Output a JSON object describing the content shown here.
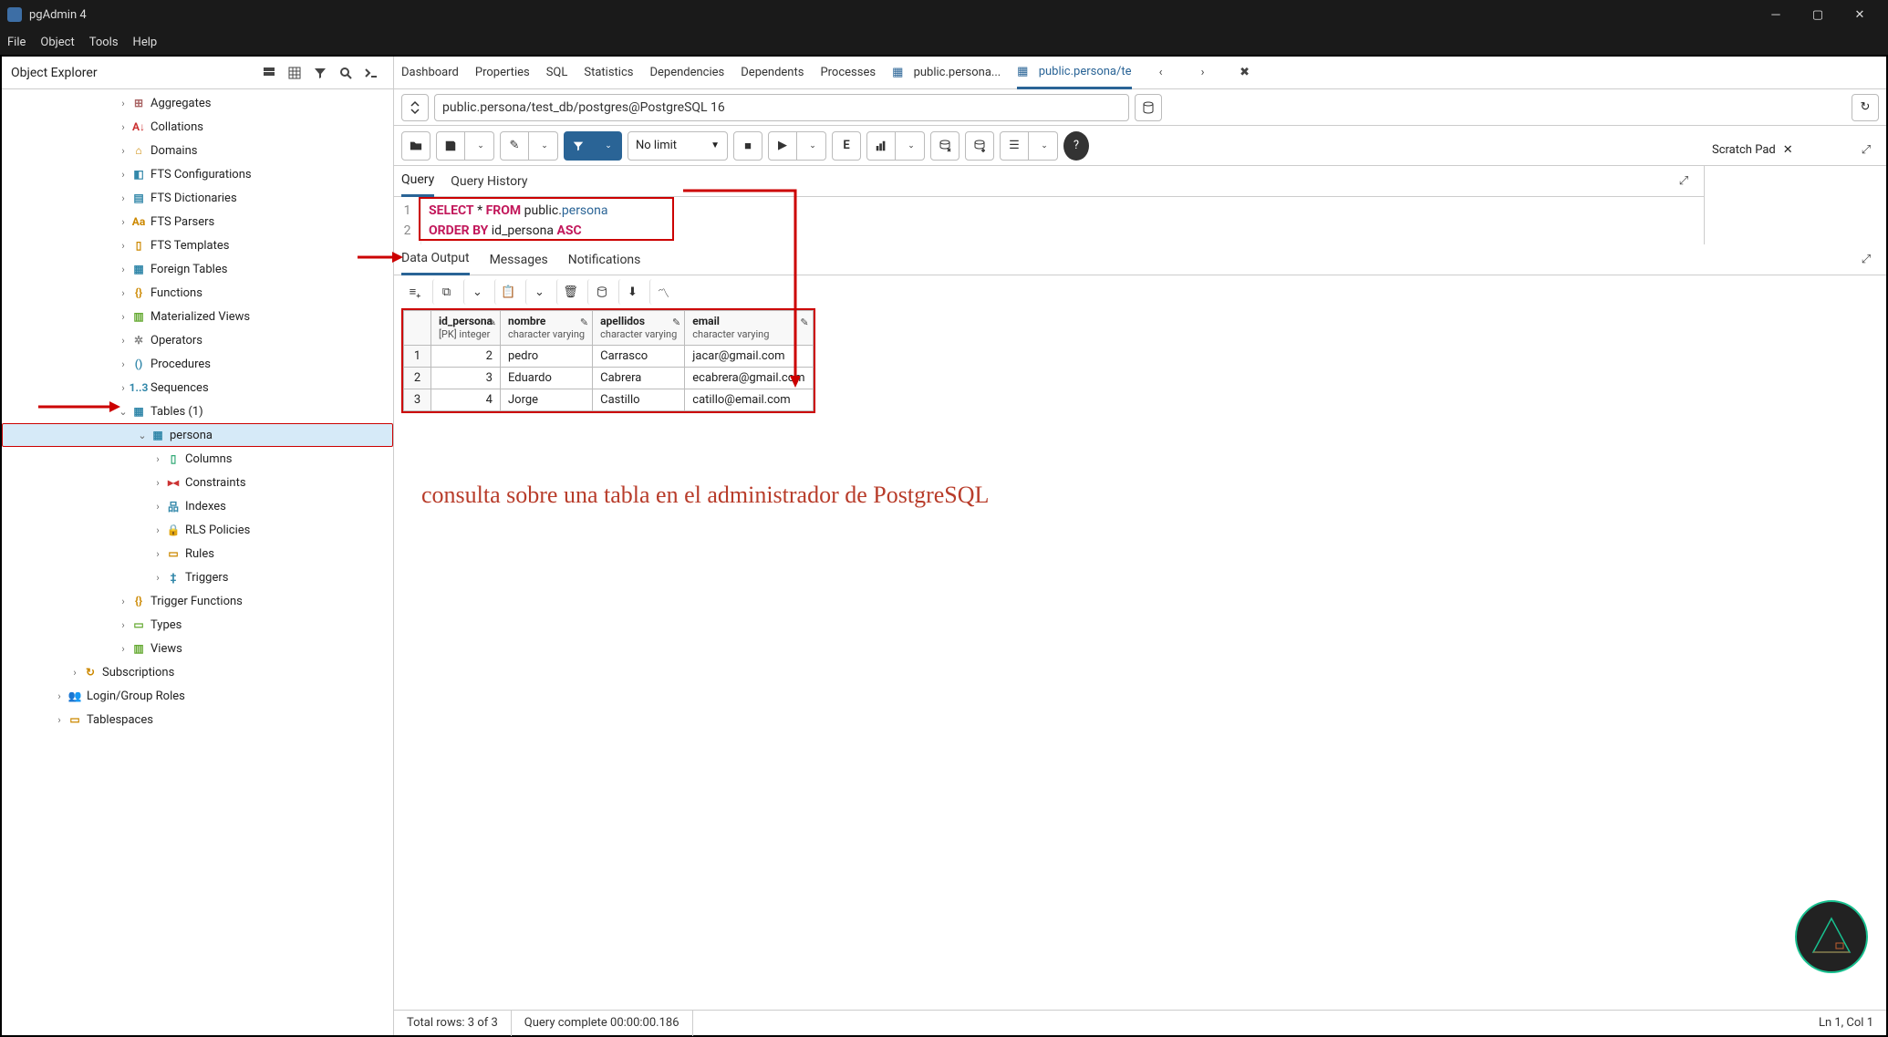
{
  "app": {
    "title": "pgAdmin 4"
  },
  "menubar": [
    "File",
    "Object",
    "Tools",
    "Help"
  ],
  "sidebar": {
    "title": "Object Explorer",
    "items": [
      {
        "label": "Aggregates",
        "indent": 125,
        "chev": "›",
        "color": "#a66",
        "glyph": "⊞"
      },
      {
        "label": "Collations",
        "indent": 125,
        "chev": "›",
        "color": "#c33",
        "glyph": "A↓"
      },
      {
        "label": "Domains",
        "indent": 125,
        "chev": "›",
        "color": "#c80",
        "glyph": "⌂"
      },
      {
        "label": "FTS Configurations",
        "indent": 125,
        "chev": "›",
        "color": "#38a",
        "glyph": "◧"
      },
      {
        "label": "FTS Dictionaries",
        "indent": 125,
        "chev": "›",
        "color": "#38a",
        "glyph": "▤"
      },
      {
        "label": "FTS Parsers",
        "indent": 125,
        "chev": "›",
        "color": "#c80",
        "glyph": "Aa"
      },
      {
        "label": "FTS Templates",
        "indent": 125,
        "chev": "›",
        "color": "#c80",
        "glyph": "▯"
      },
      {
        "label": "Foreign Tables",
        "indent": 125,
        "chev": "›",
        "color": "#38a",
        "glyph": "▦"
      },
      {
        "label": "Functions",
        "indent": 125,
        "chev": "›",
        "color": "#c80",
        "glyph": "{}"
      },
      {
        "label": "Materialized Views",
        "indent": 125,
        "chev": "›",
        "color": "#6a3",
        "glyph": "▥"
      },
      {
        "label": "Operators",
        "indent": 125,
        "chev": "›",
        "color": "#888",
        "glyph": "✲"
      },
      {
        "label": "Procedures",
        "indent": 125,
        "chev": "›",
        "color": "#38a",
        "glyph": "()"
      },
      {
        "label": "Sequences",
        "indent": 125,
        "chev": "›",
        "color": "#38a",
        "glyph": "1..3"
      },
      {
        "label": "Tables (1)",
        "indent": 125,
        "chev": "⌄",
        "color": "#38a",
        "glyph": "▦"
      },
      {
        "label": "persona",
        "indent": 145,
        "chev": "⌄",
        "color": "#38a",
        "glyph": "▦",
        "selected": true
      },
      {
        "label": "Columns",
        "indent": 163,
        "chev": "›",
        "color": "#3a7",
        "glyph": "▯"
      },
      {
        "label": "Constraints",
        "indent": 163,
        "chev": "›",
        "color": "#c33",
        "glyph": "▸◂"
      },
      {
        "label": "Indexes",
        "indent": 163,
        "chev": "›",
        "color": "#38a",
        "glyph": "品"
      },
      {
        "label": "RLS Policies",
        "indent": 163,
        "chev": "›",
        "color": "#6a3",
        "glyph": "🔒"
      },
      {
        "label": "Rules",
        "indent": 163,
        "chev": "›",
        "color": "#c80",
        "glyph": "▭"
      },
      {
        "label": "Triggers",
        "indent": 163,
        "chev": "›",
        "color": "#38a",
        "glyph": "‡"
      },
      {
        "label": "Trigger Functions",
        "indent": 125,
        "chev": "›",
        "color": "#c80",
        "glyph": "{}"
      },
      {
        "label": "Types",
        "indent": 125,
        "chev": "›",
        "color": "#6a3",
        "glyph": "▭"
      },
      {
        "label": "Views",
        "indent": 125,
        "chev": "›",
        "color": "#6a3",
        "glyph": "▥"
      },
      {
        "label": "Subscriptions",
        "indent": 72,
        "chev": "›",
        "color": "#c80",
        "glyph": "↻"
      },
      {
        "label": "Login/Group Roles",
        "indent": 55,
        "chev": "›",
        "color": "#c80",
        "glyph": "👥"
      },
      {
        "label": "Tablespaces",
        "indent": 55,
        "chev": "›",
        "color": "#c80",
        "glyph": "▭"
      }
    ]
  },
  "main": {
    "tabs": [
      "Dashboard",
      "Properties",
      "SQL",
      "Statistics",
      "Dependencies",
      "Dependents",
      "Processes"
    ],
    "doc_tabs": [
      {
        "label": "public.persona...",
        "icon": "▦"
      },
      {
        "label": "public.persona/te",
        "icon": "▦",
        "active": true
      }
    ],
    "path": "public.persona/test_db/postgres@PostgreSQL 16",
    "limit": "No limit",
    "query_tabs": [
      "Query",
      "Query History"
    ],
    "scratch_label": "Scratch Pad",
    "sql": {
      "lines": [
        "1",
        "2"
      ],
      "line1": {
        "a": "SELECT",
        "b": " * ",
        "c": "FROM",
        "d": " public",
        "e": ".",
        "f": "persona"
      },
      "line2": {
        "a": "ORDER",
        "b": " ",
        "c": "BY",
        "d": " id_persona ",
        "e": "ASC"
      }
    },
    "output_tabs": [
      "Data Output",
      "Messages",
      "Notifications"
    ],
    "columns": [
      {
        "name": "id_persona",
        "type": "[PK] integer"
      },
      {
        "name": "nombre",
        "type": "character varying"
      },
      {
        "name": "apellidos",
        "type": "character varying"
      },
      {
        "name": "email",
        "type": "character varying"
      }
    ],
    "rows": [
      {
        "n": "1",
        "id": "2",
        "nombre": "pedro",
        "apellidos": "Carrasco",
        "email": "jacar@gmail.com"
      },
      {
        "n": "2",
        "id": "3",
        "nombre": "Eduardo",
        "apellidos": "Cabrera",
        "email": "ecabrera@gmail.com"
      },
      {
        "n": "3",
        "id": "4",
        "nombre": "Jorge",
        "apellidos": "Castillo",
        "email": "catillo@email.com"
      }
    ]
  },
  "status": {
    "rows": "Total rows: 3 of 3",
    "time": "Query complete 00:00:00.186",
    "pos": "Ln 1, Col 1"
  },
  "caption": "consulta sobre una tabla en el administrador de PostgreSQL"
}
